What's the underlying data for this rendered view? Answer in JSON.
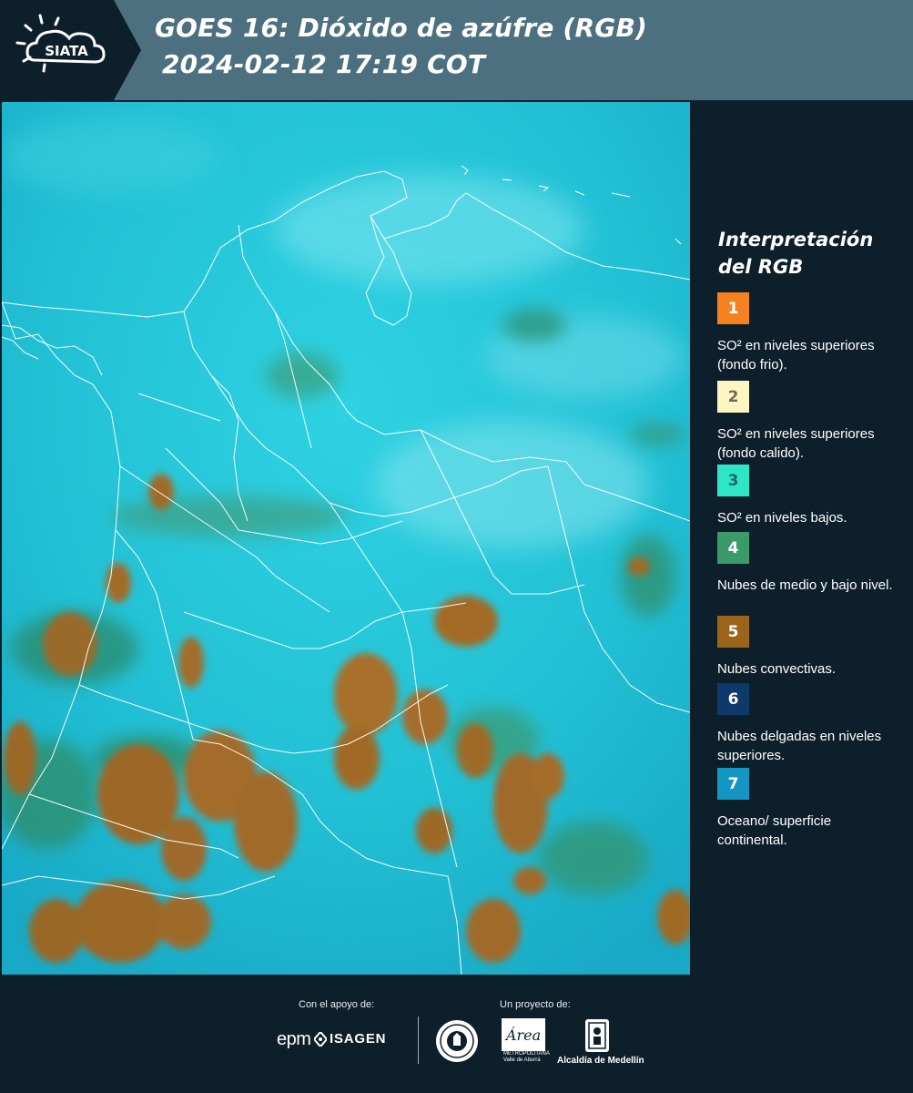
{
  "header": {
    "logo_text": "SIATA",
    "title": "GOES 16: Dióxido de azúfre (RGB)",
    "timestamp": "2024-02-12 17:19 COT"
  },
  "legend": {
    "title_line1": "Interpretación",
    "title_line2": "del RGB",
    "items": [
      {
        "number": "1",
        "label": "SO² en niveles superiores (fondo frio).",
        "color": "#f58220",
        "text_color": "#ffffff"
      },
      {
        "number": "2",
        "label": "SO² en niveles superiores (fondo calido).",
        "color": "#fdf6c3",
        "text_color": "#6b6b5a"
      },
      {
        "number": "3",
        "label": "SO² en niveles bajos.",
        "color": "#2ee6c6",
        "text_color": "#1d6b5e"
      },
      {
        "number": "4",
        "label": "Nubes de medio y bajo nivel.",
        "color": "#3a9a6a",
        "text_color": "#ffffff"
      },
      {
        "number": "5",
        "label": "Nubes convectivas.",
        "color": "#9c6418",
        "text_color": "#ffffff"
      },
      {
        "number": "6",
        "label": "Nubes delgadas en niveles superiores.",
        "color": "#0e3a6b",
        "text_color": "#ffffff"
      },
      {
        "number": "7",
        "label": "Oceano/ superficie continental.",
        "color": "#1496c2",
        "text_color": "#ffffff"
      }
    ]
  },
  "footer": {
    "support_label": "Con el apoyo de:",
    "project_label": "Un proyecto de:",
    "sponsor_1": "epm",
    "sponsor_2": "ISAGEN",
    "partner_1_line1": "Área",
    "partner_1_line2": "METROPOLITANA",
    "partner_1_line3": "Valle de Aburrá",
    "partner_2": "Alcaldía de Medellín"
  },
  "colors": {
    "header_bg": "#4d7080",
    "panel_bg": "#0e1f2c",
    "map_background": "#2cc8d6",
    "convective_cloud": "#9c6a28",
    "low_cloud": "#3a9a6a",
    "border_lines": "#ffffff"
  }
}
